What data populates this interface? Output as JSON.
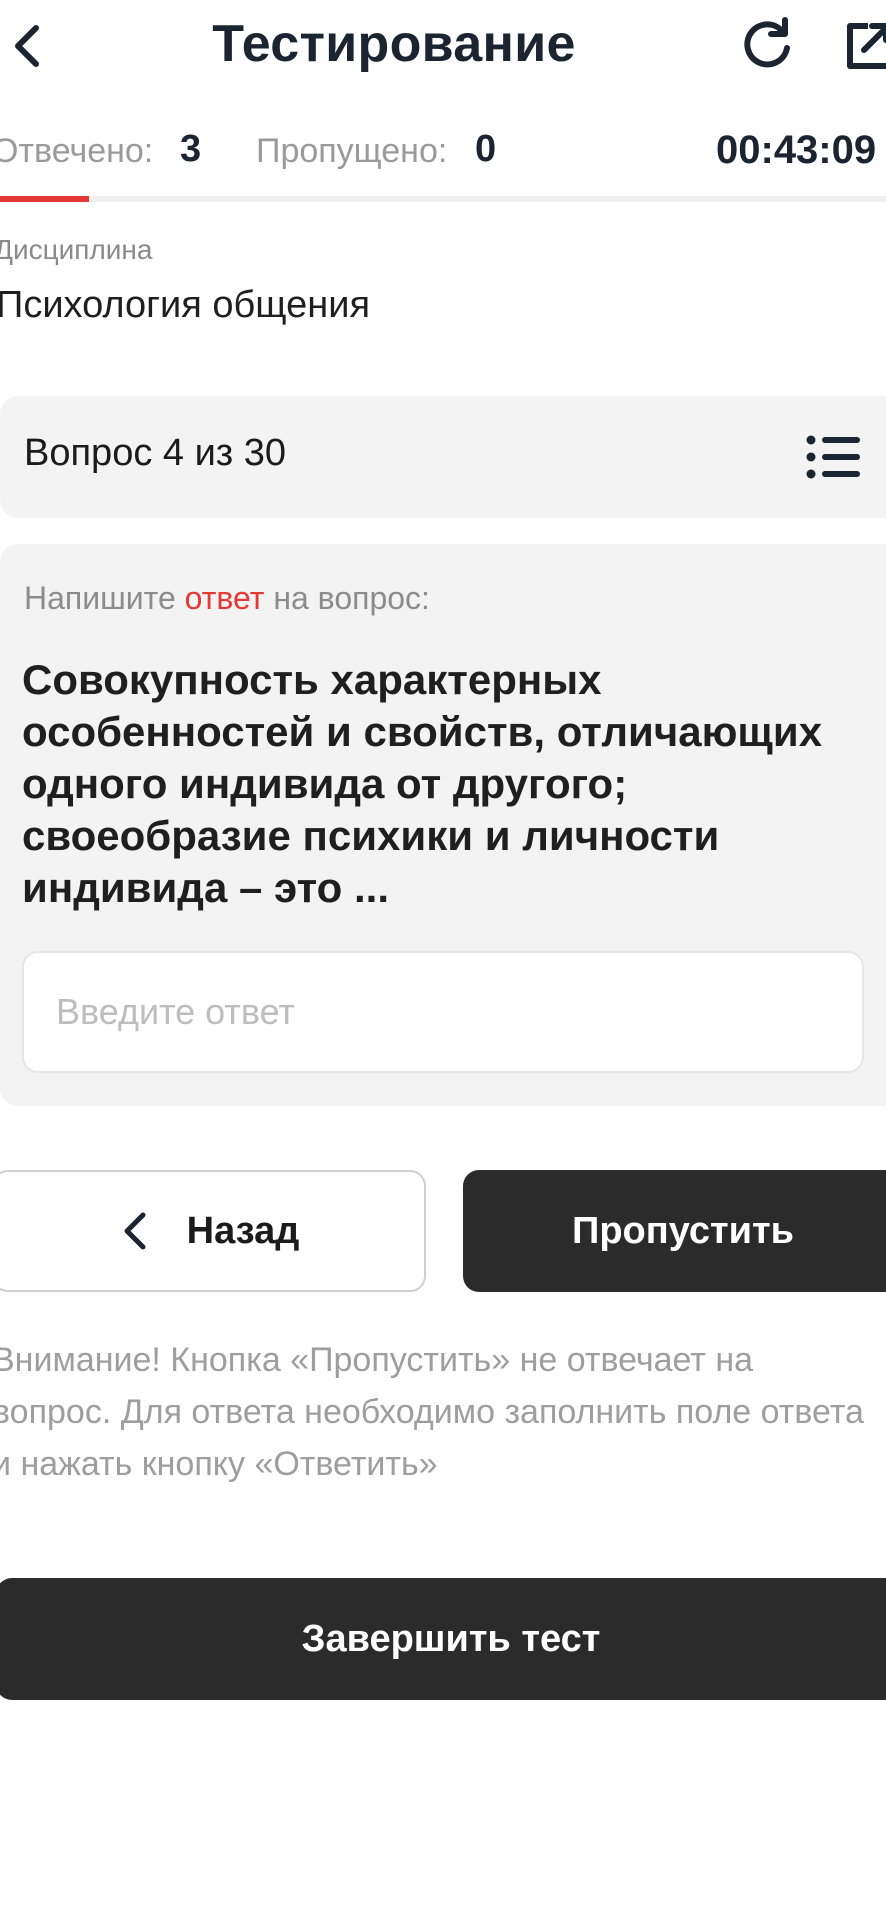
{
  "header": {
    "title": "Тестирование",
    "icons": [
      "chevron-left-icon",
      "refresh-icon",
      "share-icon"
    ]
  },
  "stats": {
    "answered_label": "Отвечено:",
    "answered_value": "3",
    "skipped_label": "Пропущено:",
    "skipped_value": "0",
    "timer": "00:43:09"
  },
  "progress": {
    "fraction": 0.1,
    "color": "#e53935"
  },
  "discipline": {
    "label": "Дисциплина",
    "value": "Психология общения"
  },
  "question_header": {
    "text": "Вопрос 4 из 30",
    "icon": "list-icon"
  },
  "question": {
    "instruction_before": "Напишите",
    "instruction_highlight": "ответ",
    "instruction_after": "на вопрос:",
    "text": "Совокупность характерных особенностей и свойств, отличающих одного индивида от другого; своеобразие психики и личности индивида – это ...",
    "answer_placeholder": "Введите ответ",
    "answer_value": ""
  },
  "buttons": {
    "back_label": "Назад",
    "skip_label": "Пропустить",
    "finish_label": "Завершить тест"
  },
  "warning": "Внимание! Кнопка «Пропустить» не отвечает на вопрос. Для ответа необходимо заполнить поле ответа и нажать кнопку «Ответить»",
  "colors": {
    "accent_red": "#e53935",
    "dark_button": "#2b2b2b",
    "card_bg": "#f3f3f3"
  }
}
